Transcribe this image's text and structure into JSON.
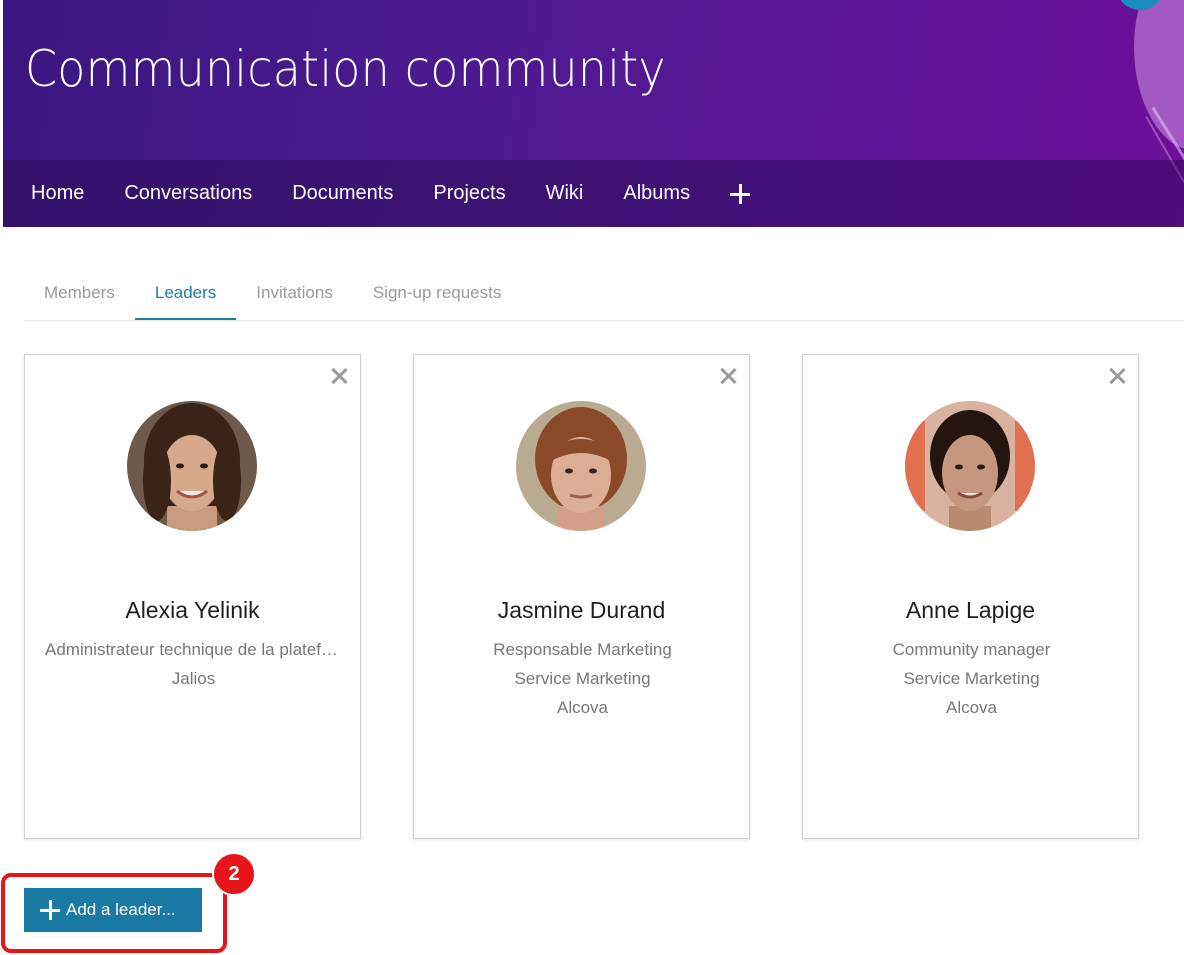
{
  "community": {
    "title": "Communication community"
  },
  "nav": {
    "items": [
      {
        "label": "Home"
      },
      {
        "label": "Conversations"
      },
      {
        "label": "Documents"
      },
      {
        "label": "Projects"
      },
      {
        "label": "Wiki"
      },
      {
        "label": "Albums"
      }
    ],
    "add_icon": "plus-icon"
  },
  "tabs": [
    {
      "label": "Members",
      "active": false
    },
    {
      "label": "Leaders",
      "active": true
    },
    {
      "label": "Invitations",
      "active": false
    },
    {
      "label": "Sign-up requests",
      "active": false
    }
  ],
  "leaders": [
    {
      "name": "Alexia Yelinik",
      "lines": [
        "Administrateur technique de la plateforme",
        "Jalios",
        ""
      ],
      "remove_icon": "close-icon"
    },
    {
      "name": "Jasmine Durand",
      "lines": [
        "Responsable Marketing",
        "Service Marketing",
        "Alcova"
      ],
      "remove_icon": "close-icon"
    },
    {
      "name": "Anne Lapige",
      "lines": [
        "Community manager",
        "Service Marketing",
        "Alcova"
      ],
      "remove_icon": "close-icon"
    }
  ],
  "actions": {
    "add_leader_label": "Add a leader...",
    "step_badge": "2"
  },
  "colors": {
    "accent": "#1b7ea6",
    "banner": "#4b1a8f",
    "highlight": "#e8141c"
  }
}
